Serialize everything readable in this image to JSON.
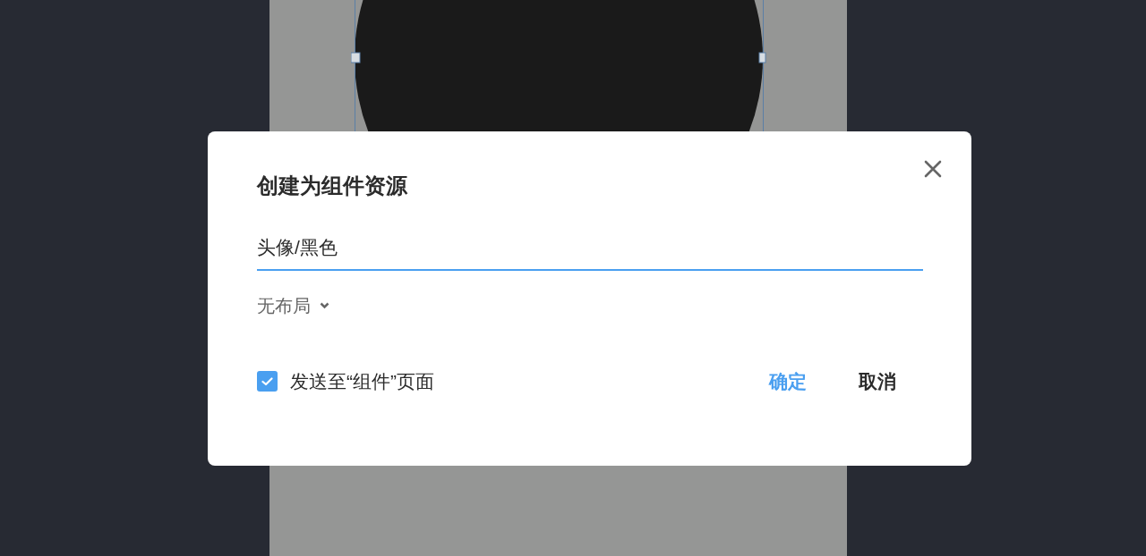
{
  "dialog": {
    "title": "创建为组件资源",
    "name_field": {
      "value": "头像/黑色"
    },
    "layout_dropdown": {
      "label": "无布局"
    },
    "send_checkbox": {
      "label": "发送至“组件”页面",
      "checked": true
    },
    "buttons": [
      {
        "label": "确定",
        "kind": "primary"
      },
      {
        "label": "取消",
        "kind": "secondary"
      }
    ]
  }
}
